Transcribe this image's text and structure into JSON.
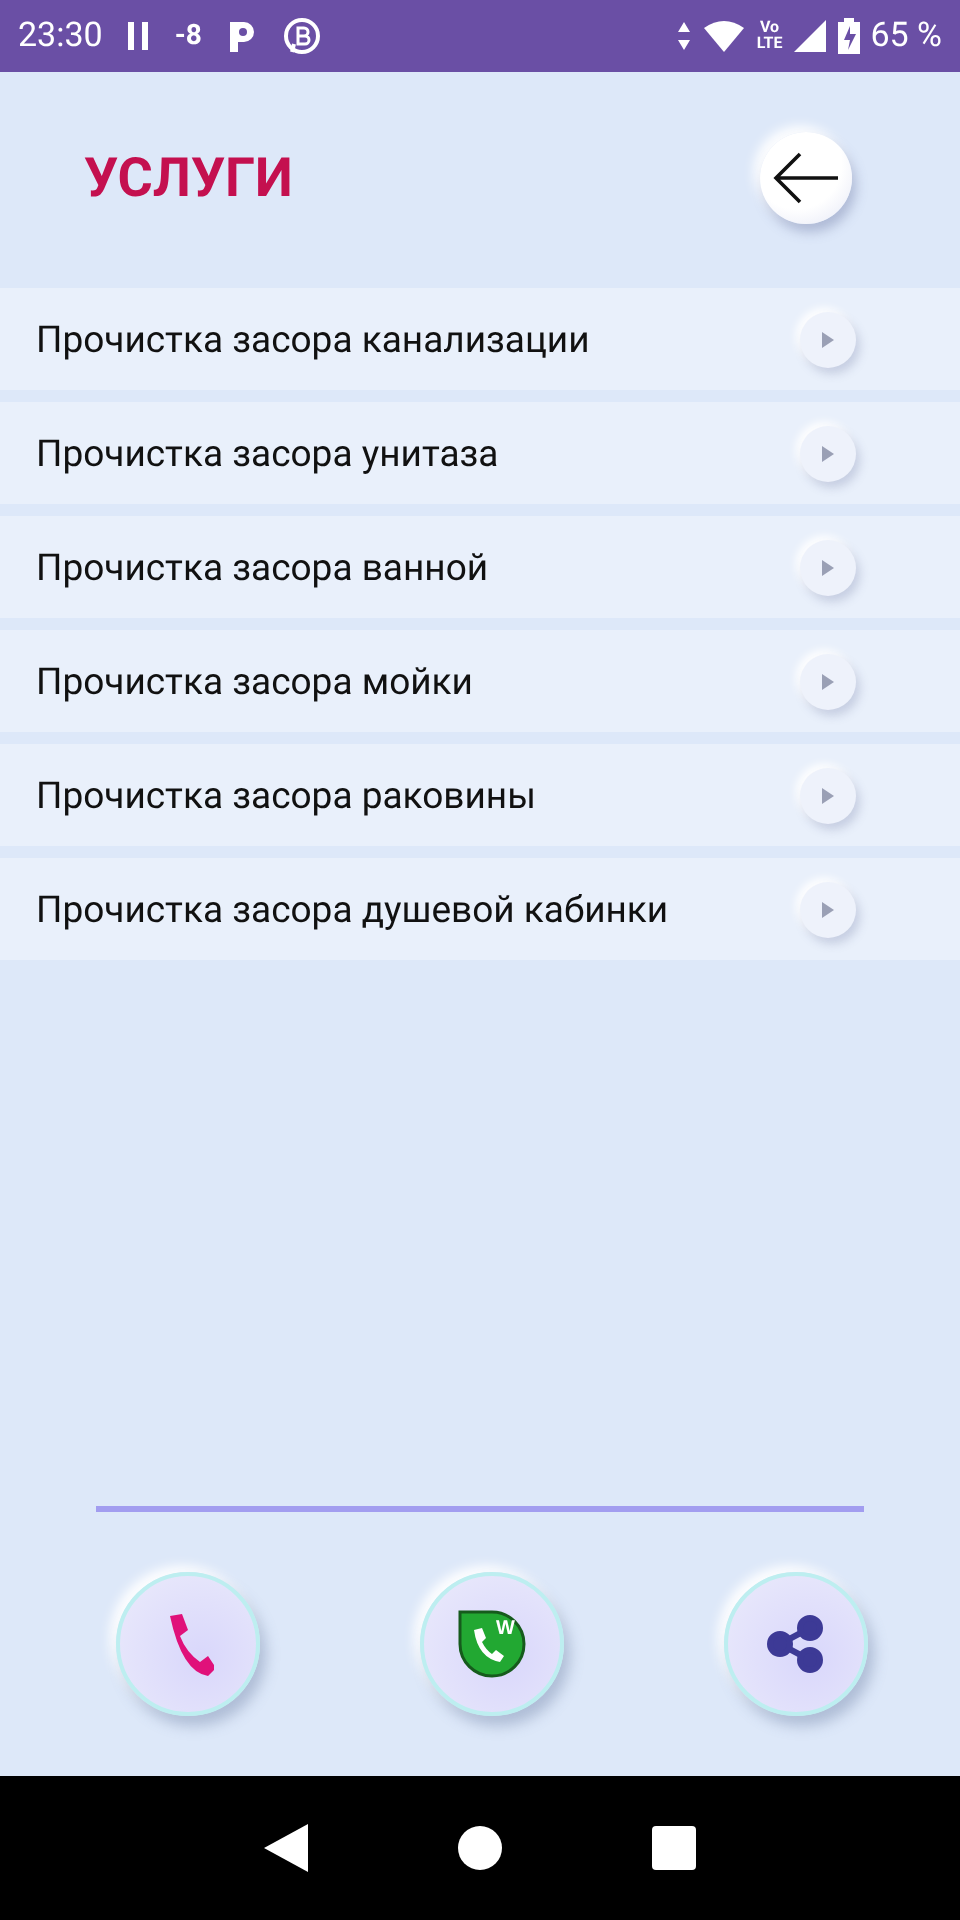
{
  "status_bar": {
    "time": "23:30",
    "notification": "-8",
    "network": "LTE",
    "volte": "Vo",
    "battery": "65 %"
  },
  "title": "УСЛУГИ",
  "services": [
    {
      "label": "Прочистка засора канализации"
    },
    {
      "label": "Прочистка засора унитаза"
    },
    {
      "label": "Прочистка засора ванной"
    },
    {
      "label": "Прочистка засора мойки"
    },
    {
      "label": "Прочистка засора раковины"
    },
    {
      "label": "Прочистка засора душевой кабинки"
    }
  ],
  "actions": [
    {
      "kind": "call"
    },
    {
      "kind": "messenger",
      "badge": "W"
    },
    {
      "kind": "share"
    }
  ]
}
